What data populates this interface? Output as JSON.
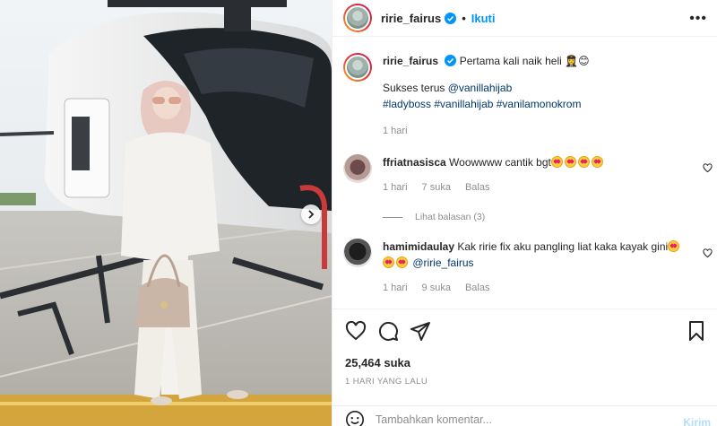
{
  "post": {
    "username": "ririe_fairus",
    "follow_label": "Ikuti",
    "separator": "•",
    "more_label": "•••"
  },
  "caption": {
    "username": "ririe_fairus",
    "text": "Pertama kali naik heli 👩‍✈️😊",
    "line2_prefix": "Sukses terus ",
    "line2_mention": "@vanillahijab",
    "hashtags": "#ladyboss #vanillahijab #vanilamonokrom",
    "time": "1 hari"
  },
  "comments": [
    {
      "username": "ffriatnasisca",
      "text": "Woowwww cantik bgt",
      "emoji_count": 4,
      "time": "1 hari",
      "likes": "7 suka",
      "reply_label": "Balas",
      "view_replies": "Lihat balasan (3)"
    },
    {
      "username": "hamimidaulay",
      "text": "Kak ririe fix aku pangling liat kaka kayak gini",
      "mention": "@ririe_fairus",
      "time": "1 hari",
      "likes": "9 suka",
      "reply_label": "Balas"
    }
  ],
  "stats": {
    "likes": "25,464 suka",
    "time_ago": "1 HARI YANG LALU"
  },
  "composer": {
    "placeholder": "Tambahkan komentar...",
    "post_label": "Kirim"
  },
  "colors": {
    "accent": "#0095f6",
    "post_disabled": "#b2dffc",
    "muted": "#8e8e8e"
  },
  "icons": [
    "verified-badge-icon",
    "more-icon",
    "heart-icon",
    "comment-icon",
    "share-icon",
    "bookmark-icon",
    "emoji-icon",
    "next-arrow-icon"
  ]
}
